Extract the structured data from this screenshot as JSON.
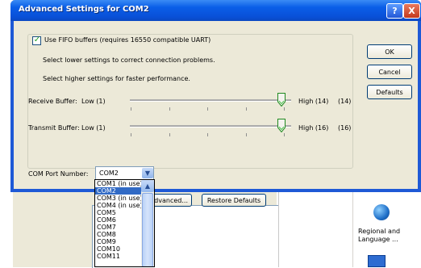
{
  "dialog": {
    "title": "Advanced Settings for COM2",
    "help_glyph": "?",
    "close_glyph": "X",
    "fifo_label": "Use FIFO buffers (requires 16550 compatible UART)",
    "fifo_checked": true,
    "hint_lower": "Select lower settings to correct connection problems.",
    "hint_higher": "Select higher settings for faster performance.",
    "receive": {
      "label": "Receive Buffer:",
      "low": "Low (1)",
      "high": "High (14)",
      "value": "(14)",
      "level": 1.0
    },
    "transmit": {
      "label": "Transmit Buffer:",
      "low": "Low (1)",
      "high": "High (16)",
      "value": "(16)",
      "level": 1.0
    },
    "buttons": {
      "ok": "OK",
      "cancel": "Cancel",
      "defaults": "Defaults"
    },
    "com_port_label": "COM Port Number:",
    "com_selected": "COM2",
    "com_options": [
      "COM1 (in use)",
      "COM2",
      "COM3 (in use)",
      "COM4 (in use)",
      "COM5",
      "COM6",
      "COM7",
      "COM8",
      "COM9",
      "COM10",
      "COM11"
    ]
  },
  "background_window": {
    "advanced_button": "Advanced...",
    "restore_defaults_button": "Restore Defaults",
    "control_panel_item": "Regional and\nLanguage ..."
  },
  "colors": {
    "title_bar": "#0a5ee8",
    "dialog_face": "#ece9d8",
    "selection": "#316ac5",
    "close_button": "#c4391d"
  },
  "icons": [
    "help-icon",
    "close-icon",
    "chevron-down-icon",
    "globe-icon",
    "monitor-icon"
  ]
}
